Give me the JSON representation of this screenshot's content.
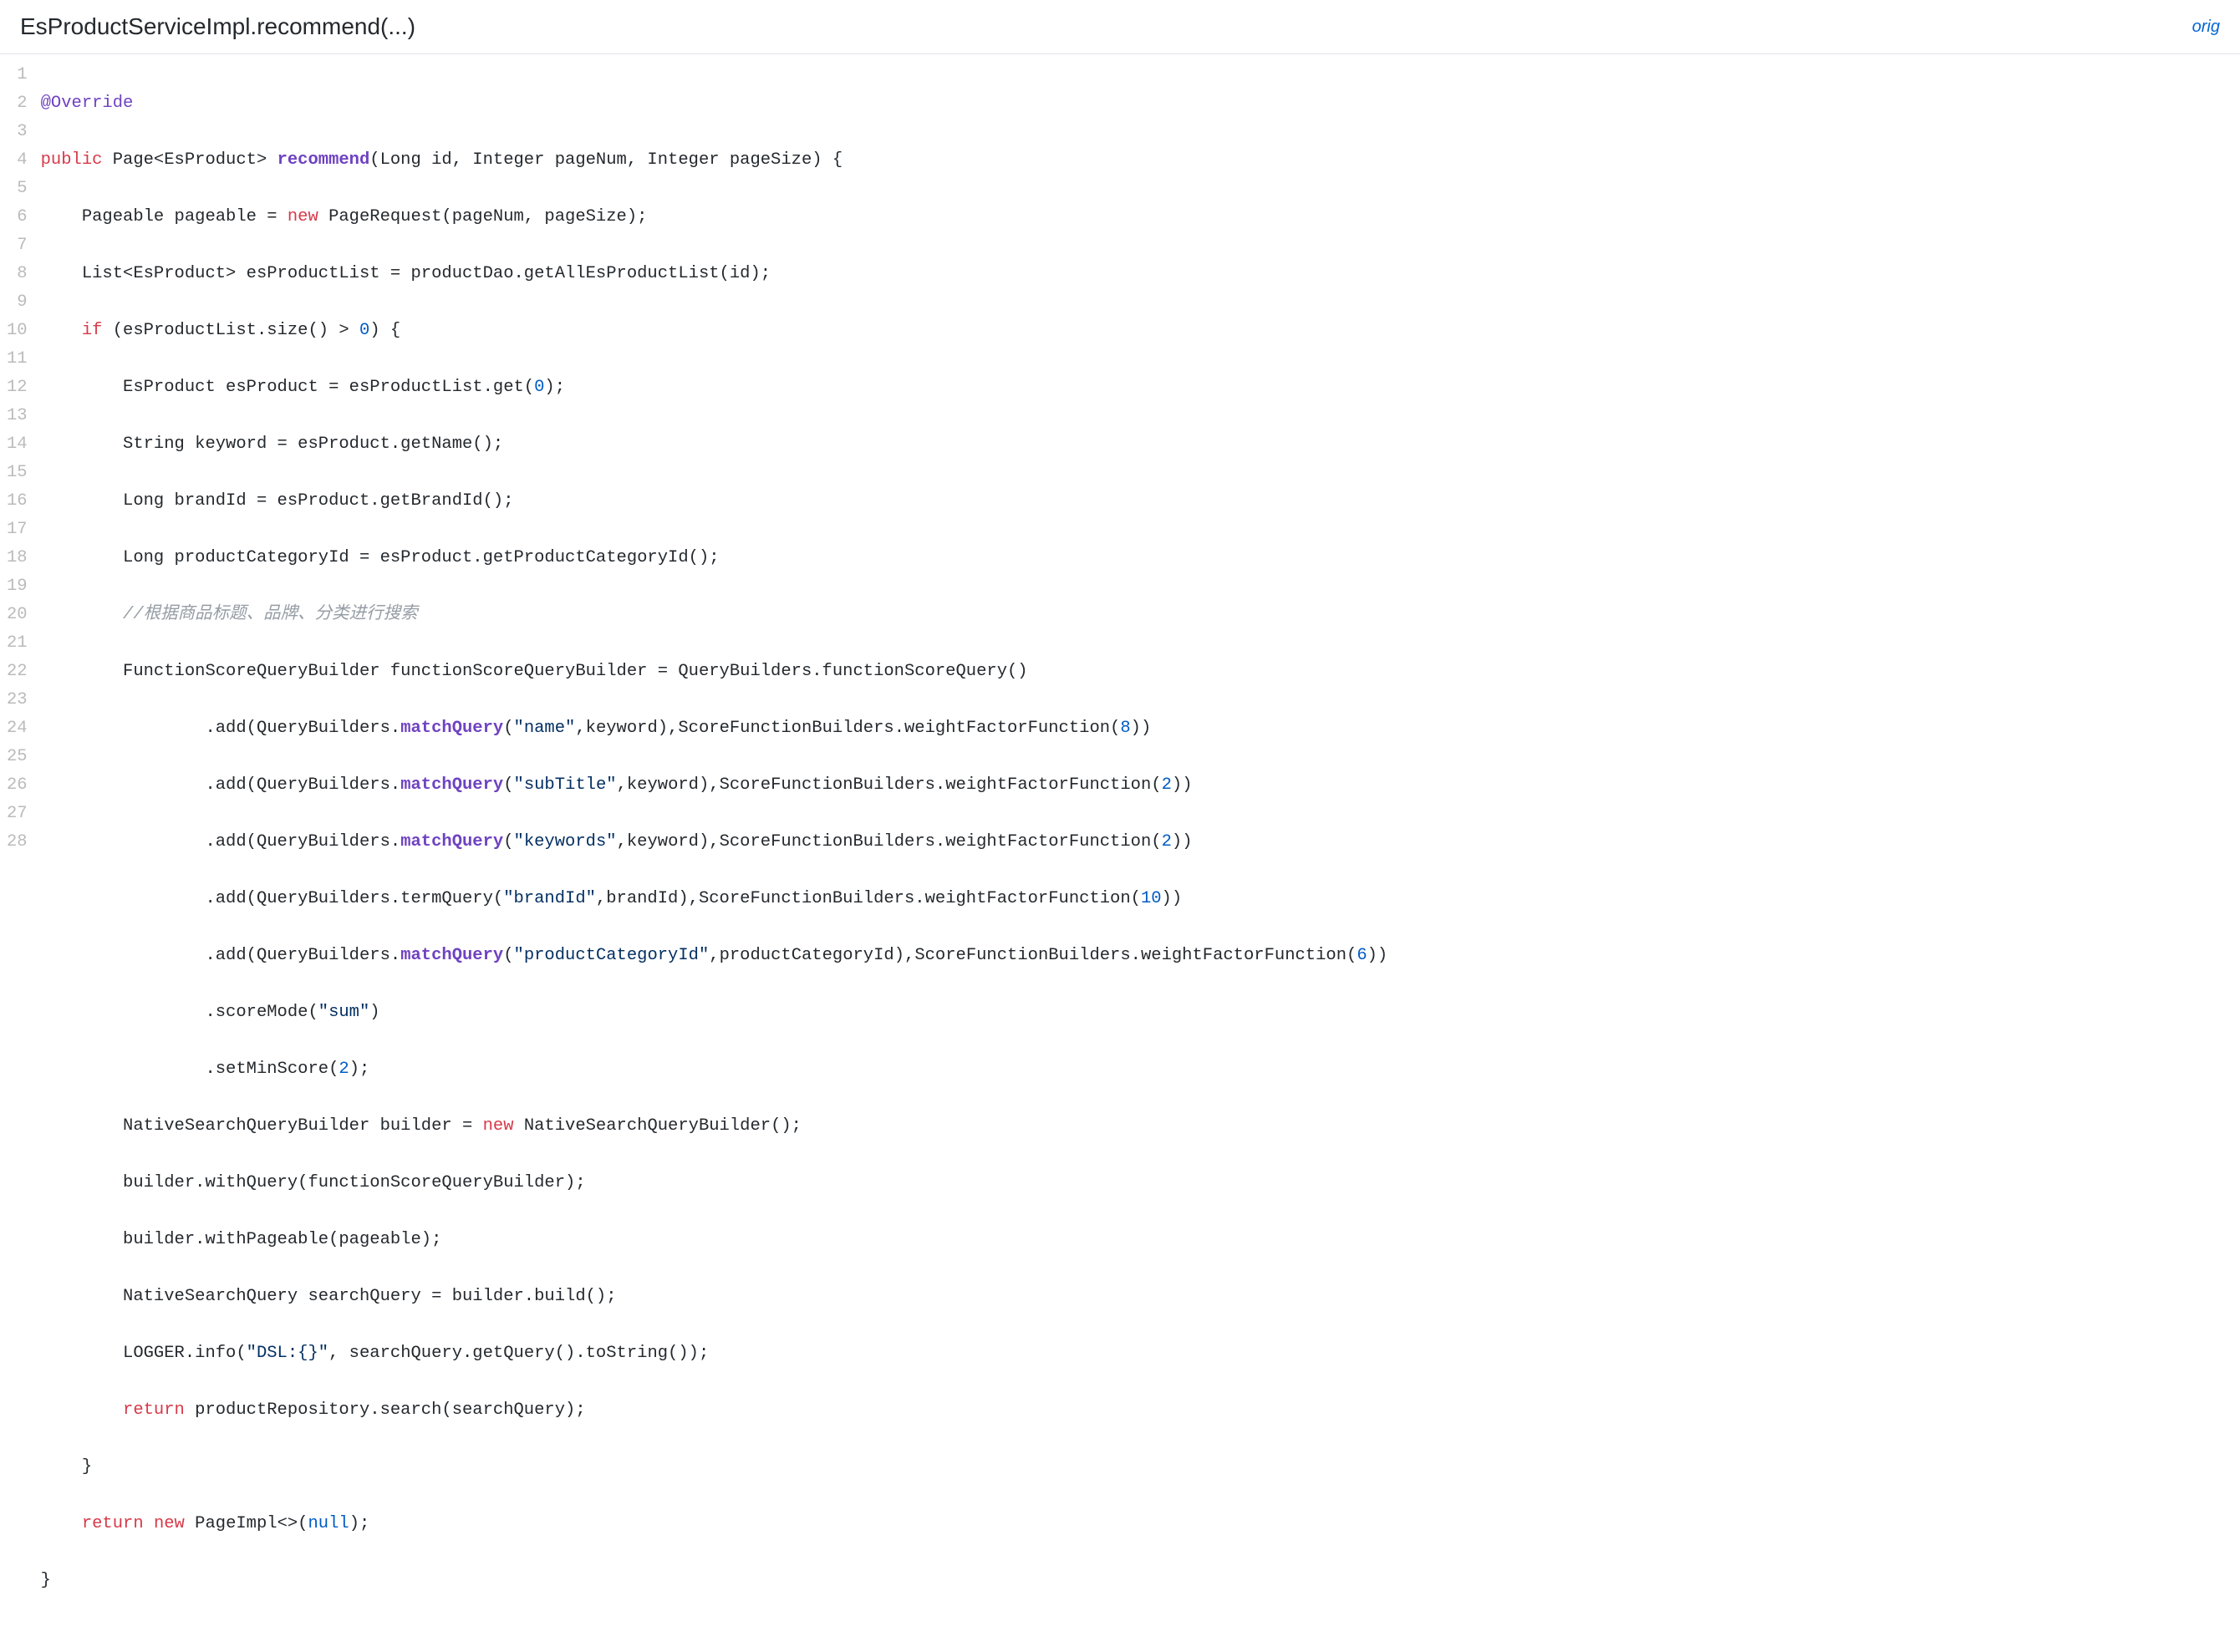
{
  "header": {
    "title": "EsProductServiceImpl.recommend(...)",
    "origin_link": "orig"
  },
  "line_numbers": [
    "1",
    "2",
    "3",
    "4",
    "5",
    "6",
    "7",
    "8",
    "9",
    "10",
    "11",
    "12",
    "13",
    "14",
    "15",
    "16",
    "17",
    "18",
    "19",
    "20",
    "21",
    "22",
    "23",
    "24",
    "25",
    "26",
    "27",
    "28"
  ],
  "code": {
    "l1": {
      "t1": "@Override"
    },
    "l2": {
      "kw1": "public",
      "t1": " Page<EsProduct> ",
      "fn1": "recommend",
      "t2": "(Long id, Integer pageNum, Integer pageSize) {"
    },
    "l3": {
      "t1": "    Pageable pageable = ",
      "kw1": "new",
      "t2": " PageRequest(pageNum, pageSize);"
    },
    "l4": {
      "t1": "    List<EsProduct> esProductList = productDao.getAllEsProductList(id);"
    },
    "l5": {
      "t1": "    ",
      "kw1": "if",
      "t2": " (esProductList.size() > ",
      "nm1": "0",
      "t3": ") {"
    },
    "l6": {
      "t1": "        EsProduct esProduct = esProductList.get(",
      "nm1": "0",
      "t2": ");"
    },
    "l7": {
      "t1": "        String keyword = esProduct.getName();"
    },
    "l8": {
      "t1": "        Long brandId = esProduct.getBrandId();"
    },
    "l9": {
      "t1": "        Long productCategoryId = esProduct.getProductCategoryId();"
    },
    "l10": {
      "cm1": "        //根据商品标题、品牌、分类进行搜索"
    },
    "l11": {
      "t1": "        FunctionScoreQueryBuilder functionScoreQueryBuilder = QueryBuilders.functionScoreQuery()"
    },
    "l12": {
      "t1": "                .add(QueryBuilders.",
      "fn1": "matchQuery",
      "t2": "(",
      "s1": "\"name\"",
      "t3": ",keyword),ScoreFunctionBuilders.weightFactorFunction(",
      "nm1": "8",
      "t4": "))"
    },
    "l13": {
      "t1": "                .add(QueryBuilders.",
      "fn1": "matchQuery",
      "t2": "(",
      "s1": "\"subTitle\"",
      "t3": ",keyword),ScoreFunctionBuilders.weightFactorFunction(",
      "nm1": "2",
      "t4": "))"
    },
    "l14": {
      "t1": "                .add(QueryBuilders.",
      "fn1": "matchQuery",
      "t2": "(",
      "s1": "\"keywords\"",
      "t3": ",keyword),ScoreFunctionBuilders.weightFactorFunction(",
      "nm1": "2",
      "t4": "))"
    },
    "l15": {
      "t1": "                .add(QueryBuilders.termQuery(",
      "s1": "\"brandId\"",
      "t2": ",brandId),ScoreFunctionBuilders.weightFactorFunction(",
      "nm1": "10",
      "t3": "))"
    },
    "l16": {
      "t1": "                .add(QueryBuilders.",
      "fn1": "matchQuery",
      "t2": "(",
      "s1": "\"productCategoryId\"",
      "t3": ",productCategoryId),ScoreFunctionBuilders.weightFactorFunction(",
      "nm1": "6",
      "t4": "))"
    },
    "l17": {
      "t1": "                .scoreMode(",
      "s1": "\"sum\"",
      "t2": ")"
    },
    "l18": {
      "t1": "                .setMinScore(",
      "nm1": "2",
      "t2": ");"
    },
    "l19": {
      "t1": "        NativeSearchQueryBuilder builder = ",
      "kw1": "new",
      "t2": " NativeSearchQueryBuilder();"
    },
    "l20": {
      "t1": "        builder.withQuery(functionScoreQueryBuilder);"
    },
    "l21": {
      "t1": "        builder.withPageable(pageable);"
    },
    "l22": {
      "t1": "        NativeSearchQuery searchQuery = builder.build();"
    },
    "l23": {
      "t1": "        LOGGER.info(",
      "s1": "\"DSL:{}\"",
      "t2": ", searchQuery.getQuery().toString());"
    },
    "l24": {
      "t1": "        ",
      "kw1": "return",
      "t2": " productRepository.search(searchQuery);"
    },
    "l25": {
      "t1": "    }"
    },
    "l26": {
      "t1": "    ",
      "kw1": "return",
      "t2": " ",
      "kw2": "new",
      "t3": " PageImpl<>(",
      "nm1": "null",
      "t4": ");"
    },
    "l27": {
      "t1": "}"
    }
  }
}
